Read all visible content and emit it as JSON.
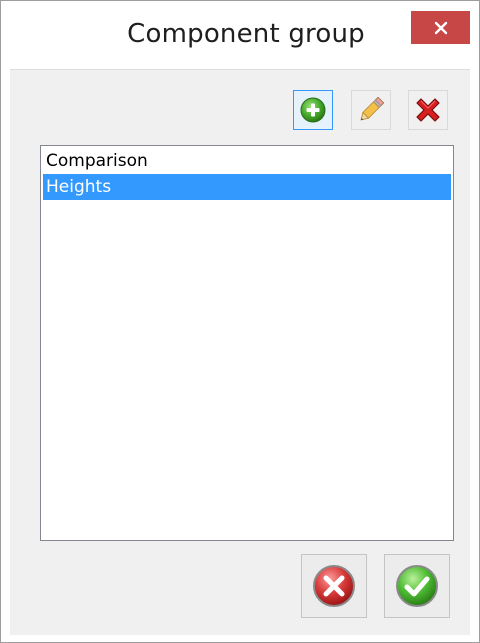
{
  "window": {
    "title": "Component group"
  },
  "toolbar": {
    "add_icon": "add-circle-icon",
    "edit_icon": "pencil-icon",
    "delete_icon": "red-x-icon"
  },
  "list": {
    "items": [
      {
        "label": "Comparison",
        "selected": false
      },
      {
        "label": "Heights",
        "selected": true
      }
    ]
  },
  "dialog_buttons": {
    "cancel_icon": "cancel-circle-icon",
    "ok_icon": "ok-check-icon"
  },
  "colors": {
    "close_button": "#c74646",
    "selection": "#3399ff",
    "client_bg": "#f0f0f0"
  }
}
